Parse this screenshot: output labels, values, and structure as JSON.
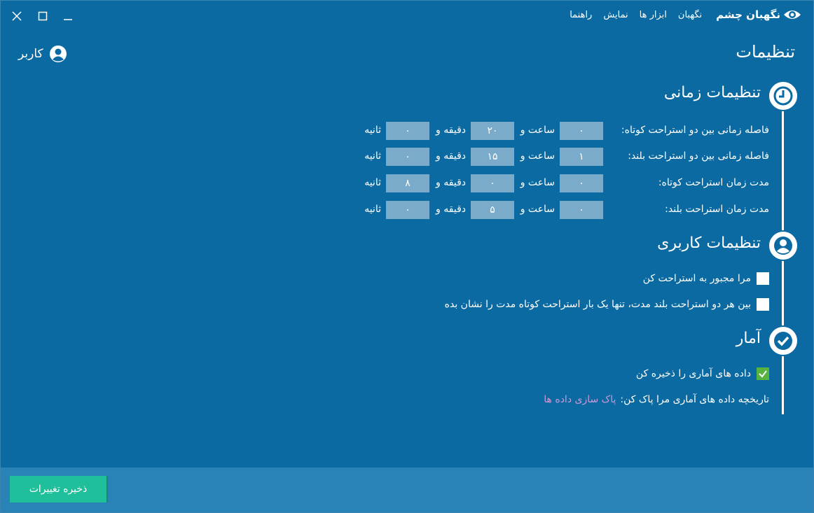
{
  "app": {
    "name": "نگهبان چشم",
    "menu": [
      "نگهبان",
      "ابزار ها",
      "نمایش",
      "راهنما"
    ]
  },
  "page_title": "تنظیمات",
  "user_label": "کاربر",
  "time_section": {
    "title": "تنظیمات زمانی",
    "unit_hour": "ساعت و",
    "unit_minute": "دقیقه و",
    "unit_second": "ثانیه",
    "rows": [
      {
        "label": "فاصله زمانی بین دو استراحت کوتاه:",
        "hours": "۰",
        "minutes": "۲۰",
        "seconds": "۰"
      },
      {
        "label": "فاصله زمانی بین دو استراحت بلند:",
        "hours": "۱",
        "minutes": "۱۵",
        "seconds": "۰"
      },
      {
        "label": "مدت زمان استراحت کوتاه:",
        "hours": "۰",
        "minutes": "۰",
        "seconds": "۸"
      },
      {
        "label": "مدت زمان استراحت بلند:",
        "hours": "۰",
        "minutes": "۵",
        "seconds": "۰"
      }
    ]
  },
  "user_section": {
    "title": "تنظیمات کاربری",
    "options": [
      {
        "label": "مرا مجبور به استراحت کن",
        "checked": false
      },
      {
        "label": "بین هر دو استراحت بلند مدت، تنها یک بار استراحت کوتاه مدت را نشان بده",
        "checked": false
      }
    ]
  },
  "stats_section": {
    "title": "آمار",
    "save_stats": {
      "label": "داده های آماری را ذخیره کن",
      "checked": true
    },
    "clear_history_label": "تاریخچه داده های آماری مرا پاک کن:",
    "clear_link": "پاک سازی داده ها"
  },
  "save_button": "ذخیره تغییرات",
  "colors": {
    "background": "#0a6aa1",
    "input": "#7aabca",
    "accent_green": "#1ebf9a",
    "check_green": "#56b33f",
    "link": "#c99ad6"
  }
}
